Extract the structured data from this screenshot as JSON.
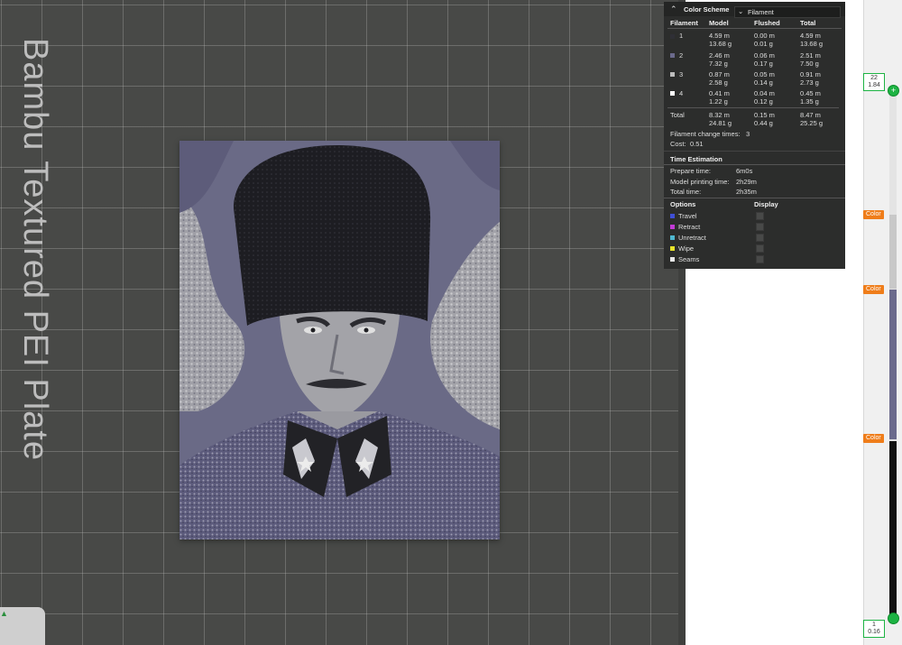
{
  "plate": {
    "label": "Bambu Textured PEI Plate"
  },
  "panel": {
    "color_scheme_label": "Color Scheme",
    "scheme_value": "Filament",
    "columns": [
      "Filament",
      "Model",
      "Flushed",
      "Total"
    ],
    "filaments": [
      {
        "id": "1",
        "color": "#2f2f35",
        "model_len": "4.59 m",
        "model_wt": "13.68 g",
        "flushed_len": "0.00 m",
        "flushed_wt": "0.01 g",
        "total_len": "4.59 m",
        "total_wt": "13.68 g"
      },
      {
        "id": "2",
        "color": "#6b6a8c",
        "model_len": "2.46 m",
        "model_wt": "7.32 g",
        "flushed_len": "0.06 m",
        "flushed_wt": "0.17 g",
        "total_len": "2.51 m",
        "total_wt": "7.50 g"
      },
      {
        "id": "3",
        "color": "#bdbdbd",
        "model_len": "0.87 m",
        "model_wt": "2.58 g",
        "flushed_len": "0.05 m",
        "flushed_wt": "0.14 g",
        "total_len": "0.91 m",
        "total_wt": "2.73 g"
      },
      {
        "id": "4",
        "color": "#ffffff",
        "model_len": "0.41 m",
        "model_wt": "1.22 g",
        "flushed_len": "0.04 m",
        "flushed_wt": "0.12 g",
        "total_len": "0.45 m",
        "total_wt": "1.35 g"
      }
    ],
    "total": {
      "label": "Total",
      "model_len": "8.32 m",
      "model_wt": "24.81 g",
      "flushed_len": "0.15 m",
      "flushed_wt": "0.44 g",
      "total_len": "8.47 m",
      "total_wt": "25.25 g"
    },
    "change_times_label": "Filament change times:",
    "change_times_value": "3",
    "cost_label": "Cost:",
    "cost_value": "0.51",
    "time_heading": "Time Estimation",
    "prepare_label": "Prepare time:",
    "prepare_value": "6m0s",
    "printing_label": "Model printing time:",
    "printing_value": "2h29m",
    "total_time_label": "Total time:",
    "total_time_value": "2h35m",
    "options_heading": "Options",
    "display_heading": "Display",
    "options": [
      {
        "label": "Travel",
        "color": "#3f4fd6"
      },
      {
        "label": "Retract",
        "color": "#c23bd6"
      },
      {
        "label": "Unretract",
        "color": "#4fb8d0"
      },
      {
        "label": "Wipe",
        "color": "#e6e22a"
      },
      {
        "label": "Seams",
        "color": "#e8e8e8"
      }
    ]
  },
  "slider": {
    "top_layer": "22",
    "top_height": "1.84",
    "bottom_layer": "1",
    "bottom_height": "0.16",
    "color_tag": "Color"
  }
}
